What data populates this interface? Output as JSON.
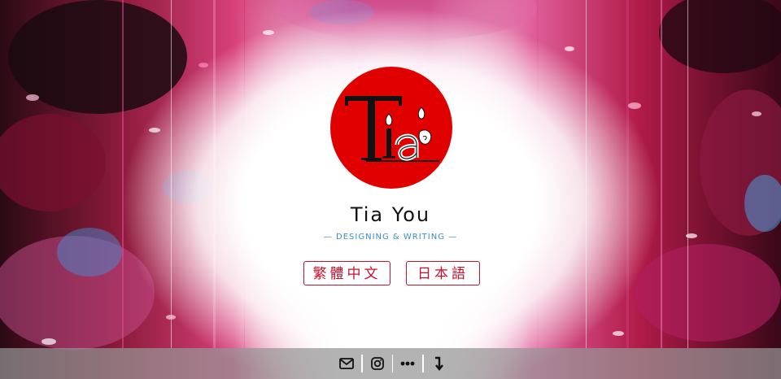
{
  "site": {
    "name": "Tia You",
    "tagline": "— DESIGNING & WRITING —",
    "logo_text": "Tia"
  },
  "languages": [
    {
      "label": "繁體中文"
    },
    {
      "label": "日本語"
    }
  ],
  "footer": {
    "icons": [
      "mail-icon",
      "instagram-icon",
      "more-icon",
      "scroll-down-icon"
    ]
  },
  "colors": {
    "logo_red": "#e00000",
    "button_red": "#c8102e",
    "tagline_blue": "#3a8ec4",
    "footer_gray": "#969696"
  }
}
